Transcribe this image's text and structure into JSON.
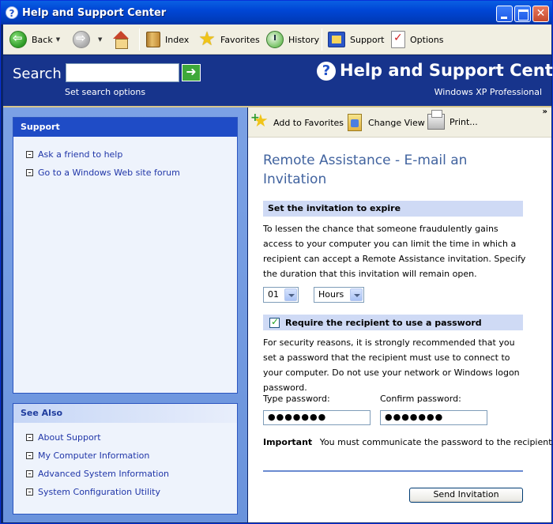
{
  "window": {
    "title": "Help and Support Center"
  },
  "toolbar": {
    "back": "Back",
    "index": "Index",
    "favorites": "Favorites",
    "history": "History",
    "support": "Support",
    "options": "Options"
  },
  "header": {
    "search_label": "Search",
    "search_value": "",
    "search_options": "Set search options",
    "brand_title": "Help and Support Center",
    "brand_subtitle": "Windows XP Professional"
  },
  "sidebar": {
    "support": {
      "title": "Support",
      "items": [
        "Ask a friend to help",
        "Go to a Windows Web site forum"
      ]
    },
    "see_also": {
      "title": "See Also",
      "items": [
        "About Support",
        "My Computer Information",
        "Advanced System Information",
        "System Configuration Utility"
      ]
    }
  },
  "content_toolbar": {
    "add_to_favorites": "Add to Favorites",
    "change_view": "Change View",
    "print": "Print...",
    "more": "»"
  },
  "content": {
    "title": "Remote Assistance - E-mail an Invitation",
    "expire_heading": "Set the invitation to expire",
    "expire_text": "To lessen the chance that someone fraudulently gains access to your computer you can limit the time in which a recipient can accept a Remote Assistance invitation. Specify the duration that this invitation will remain open.",
    "duration_value": "01",
    "duration_unit": "Hours",
    "password_heading": "Require the recipient to use a password",
    "password_checked": true,
    "password_text": "For security reasons, it is strongly recommended that you set a password that the recipient must use to connect to your computer. Do not use your network or Windows logon password.",
    "type_password_label": "Type password:",
    "confirm_password_label": "Confirm password:",
    "type_password_value": "●●●●●●●",
    "confirm_password_value": "●●●●●●●",
    "important_label": "Important",
    "important_text": "You must communicate the password to the recipient.",
    "send_button": "Send Invitation"
  },
  "colors": {
    "header_bg": "#17348c",
    "sidebar_bg": "#7ba1e5",
    "title_color": "#41639f",
    "band_bg": "#cfdaf5"
  }
}
